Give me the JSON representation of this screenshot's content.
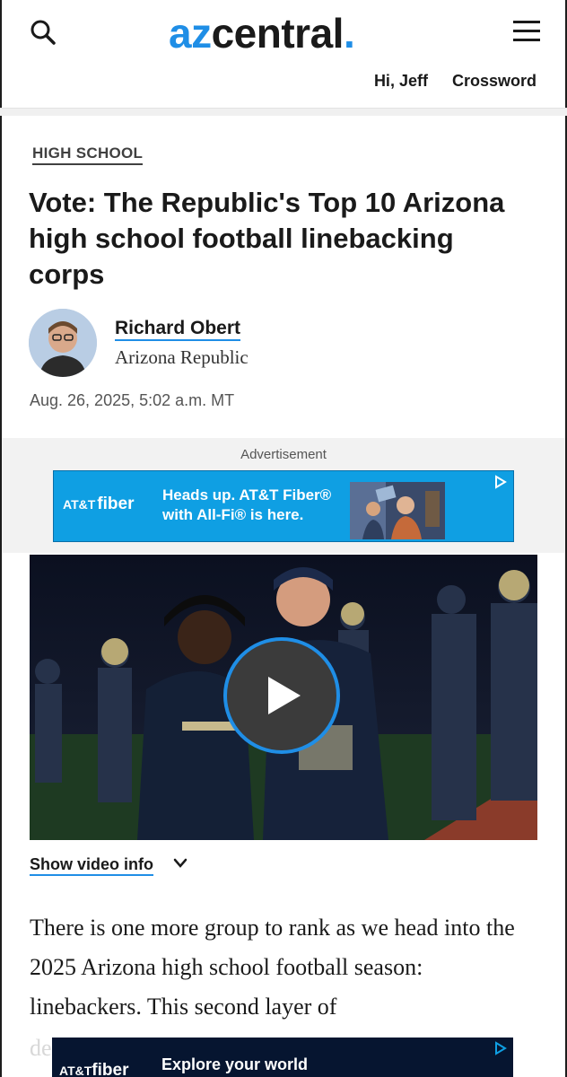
{
  "header": {
    "logo_az": "az",
    "logo_central": "central",
    "logo_dot": ".",
    "greeting": "Hi, Jeff",
    "crossword": "Crossword",
    "search_icon": "search-icon",
    "menu_icon": "hamburger-menu-icon"
  },
  "article": {
    "section": "HIGH SCHOOL",
    "headline": "Vote: The Republic's Top 10 Arizona high school football linebacking corps",
    "author_name": "Richard Obert",
    "author_org": "Arizona Republic",
    "date": "Aug. 26, 2025, 5:02 a.m. MT",
    "body_paragraph": "There is one more group to rank as we head into the 2025 Arizona high school football season: linebackers. This second layer of",
    "body_faded": "de"
  },
  "ad": {
    "label": "Advertisement",
    "brand_att": "AT&T",
    "brand_fiber": "fiber",
    "headline": "Heads up. AT&T Fiber® with All-Fi® is here.",
    "choices_icon": "adchoices-icon"
  },
  "video": {
    "show_info": "Show video info",
    "play_icon": "play-icon",
    "chevron_icon": "chevron-down-icon"
  },
  "bottom_ad": {
    "brand_att": "AT&T",
    "brand_fiber": "fiber",
    "cta": "Explore your world"
  },
  "colors": {
    "accent": "#1f8ee6",
    "ad_blue": "#0f9fe3",
    "text": "#1a1a1a"
  }
}
